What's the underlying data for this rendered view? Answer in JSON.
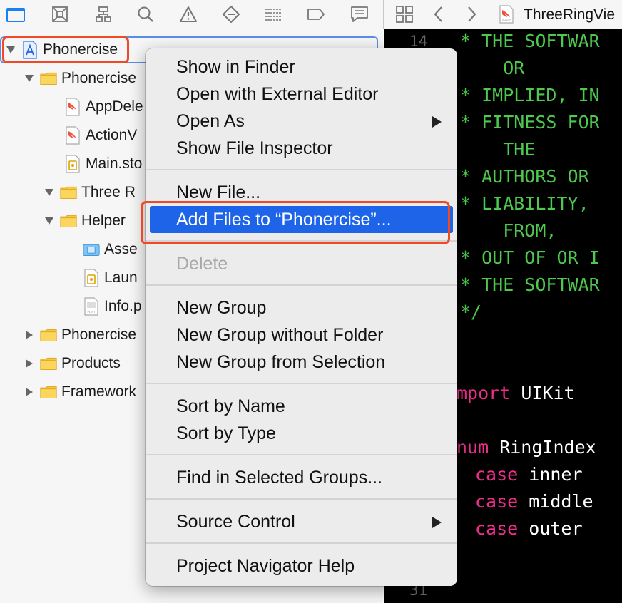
{
  "toolbar": {
    "nav_icons": [
      "folder-icon",
      "source-control-icon",
      "hierarchy-icon",
      "search-icon",
      "warning-icon",
      "test-diamond-icon",
      "debug-list-icon",
      "breakpoint-icon",
      "report-icon"
    ],
    "editor_icons": [
      "grid-icon",
      "back-chevron-icon",
      "forward-chevron-icon",
      "swift-file-icon"
    ],
    "file_tab": "ThreeRingVie"
  },
  "navigator": {
    "items": [
      {
        "label": "Phonercise",
        "icon": "project-icon"
      },
      {
        "label": "Phonercise",
        "icon": "folder-icon"
      },
      {
        "label": "AppDele",
        "icon": "swift-file-icon"
      },
      {
        "label": "ActionV",
        "icon": "swift-file-icon"
      },
      {
        "label": "Main.sto",
        "icon": "storyboard-icon"
      },
      {
        "label": "Three R",
        "icon": "folder-icon"
      },
      {
        "label": "Helper",
        "icon": "folder-icon"
      },
      {
        "label": "Asse",
        "icon": "asset-catalog-icon"
      },
      {
        "label": "Laun",
        "icon": "storyboard-icon"
      },
      {
        "label": "Info.p",
        "icon": "plist-icon"
      },
      {
        "label": "Phonercise",
        "icon": "folder-icon"
      },
      {
        "label": "Products",
        "icon": "folder-icon"
      },
      {
        "label": "Framework",
        "icon": "folder-icon"
      }
    ]
  },
  "editor": {
    "line_numbers": [
      "14",
      "31"
    ],
    "code": [
      {
        "text": "* THE SOFTWAR",
        "color": "#4ec94e"
      },
      {
        "text": "    OR",
        "color": "#4ec94e"
      },
      {
        "text": "* IMPLIED, IN",
        "color": "#4ec94e"
      },
      {
        "text": "* FITNESS FOR",
        "color": "#4ec94e"
      },
      {
        "text": "    THE",
        "color": "#4ec94e"
      },
      {
        "text": "* AUTHORS OR ",
        "color": "#4ec94e"
      },
      {
        "text": "* LIABILITY, ",
        "color": "#4ec94e"
      },
      {
        "text": "    FROM,",
        "color": "#4ec94e"
      },
      {
        "text": "* OUT OF OR I",
        "color": "#4ec94e"
      },
      {
        "text": "* THE SOFTWAR",
        "color": "#4ec94e"
      },
      {
        "text": "*/",
        "color": "#4ec94e"
      },
      {
        "kw": "mport",
        "rest": " UIKit"
      },
      {
        "kw": "num",
        "rest": " RingIndex"
      },
      {
        "kw": "case",
        "rest": " inner"
      },
      {
        "kw": "case",
        "rest": " middle"
      },
      {
        "kw": "case",
        "rest": " outer"
      }
    ],
    "colors": {
      "comment": "#4ec94e",
      "keyword": "#ee2e8a",
      "plain": "#ffffff"
    }
  },
  "context_menu": {
    "items": [
      "Show in Finder",
      "Open with External Editor",
      "Open As",
      "Show File Inspector",
      "New File...",
      "Add Files to “Phonercise”...",
      "Delete",
      "New Group",
      "New Group without Folder",
      "New Group from Selection",
      "Sort by Name",
      "Sort by Type",
      "Find in Selected Groups...",
      "Source Control",
      "Project Navigator Help"
    ],
    "highlighted": "Add Files to “Phonercise”...",
    "disabled": [
      "Delete"
    ],
    "submenus": [
      "Open As",
      "Source Control"
    ]
  },
  "colors": {
    "accent": "#1d64e8",
    "annotation": "#ef4a25",
    "nav_icon_active": "#1a7ef5"
  }
}
